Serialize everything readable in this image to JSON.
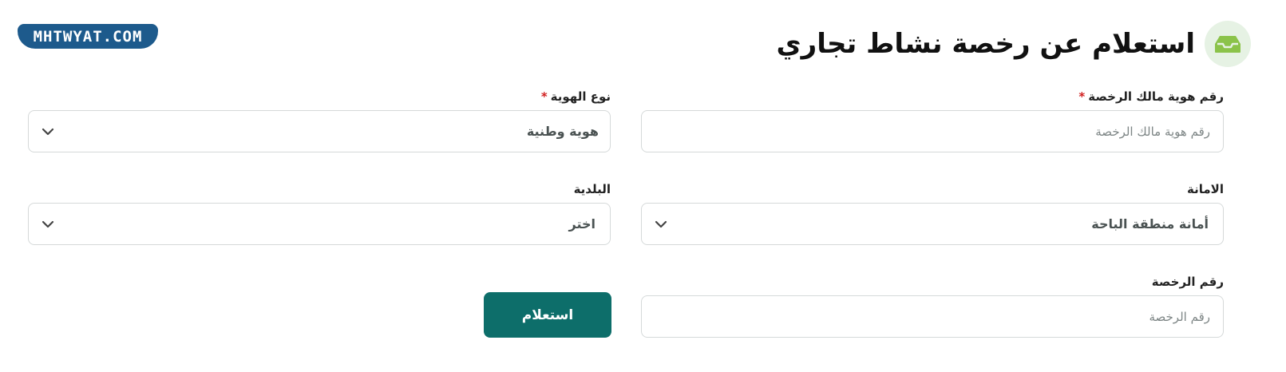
{
  "watermark": {
    "text": "MHTWYAT.COM"
  },
  "header": {
    "title": "استعلام عن رخصة نشاط تجاري",
    "icon": "inbox-tray-icon",
    "icon_bg": "#e6f2e4",
    "icon_color": "#8bc34a"
  },
  "form": {
    "owner_id": {
      "label": "رقم هوية مالك الرخصة",
      "required_mark": "*",
      "placeholder": "رقم هوية مالك الرخصة",
      "value": ""
    },
    "id_type": {
      "label": "نوع الهوية",
      "required_mark": "*",
      "selected": "هوية وطنية"
    },
    "amanah": {
      "label": "الامانة",
      "selected": "أمانة منطقة الباحة"
    },
    "municipality": {
      "label": "البلدية",
      "selected": "اختر"
    },
    "license_number": {
      "label": "رقم الرخصة",
      "placeholder": "رقم الرخصة",
      "value": ""
    },
    "submit_label": "استعلام"
  },
  "colors": {
    "primary": "#0d6e6a",
    "required": "#d11f1f",
    "border": "#d5d9d9",
    "watermark_bg": "#1d5a8c"
  }
}
